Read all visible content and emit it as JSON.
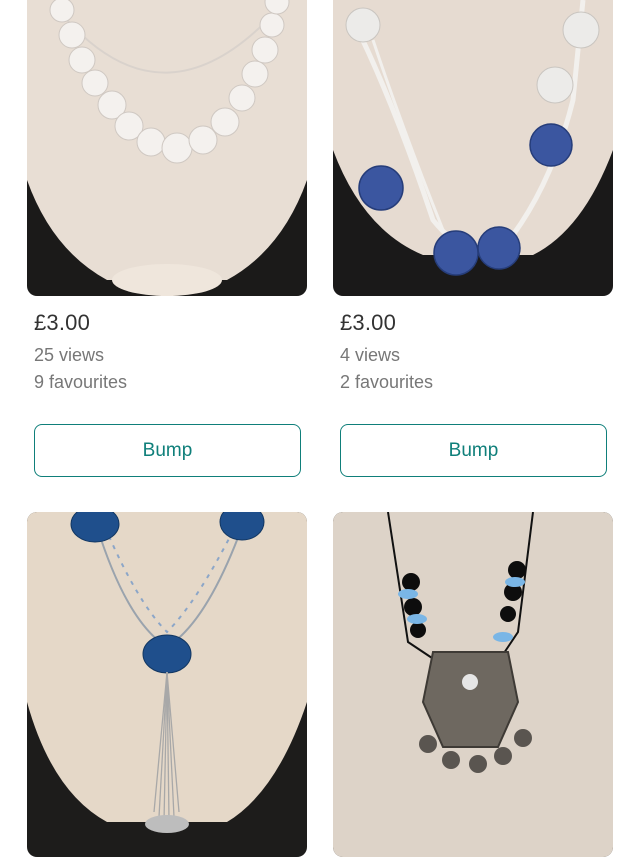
{
  "listings": [
    {
      "image": "pearl-necklace-photo",
      "price": "£3.00",
      "views": "25 views",
      "favourites": "9 favourites",
      "bump_label": "Bump"
    },
    {
      "image": "blue-bead-necklace-photo",
      "price": "£3.00",
      "views": "4 views",
      "favourites": "2 favourites",
      "bump_label": "Bump"
    },
    {
      "image": "blue-tassel-necklace-photo"
    },
    {
      "image": "silver-pendant-necklace-photo"
    }
  ],
  "colors": {
    "accent": "#0f7f7a",
    "price_text": "#333333",
    "meta_text": "#777777"
  }
}
